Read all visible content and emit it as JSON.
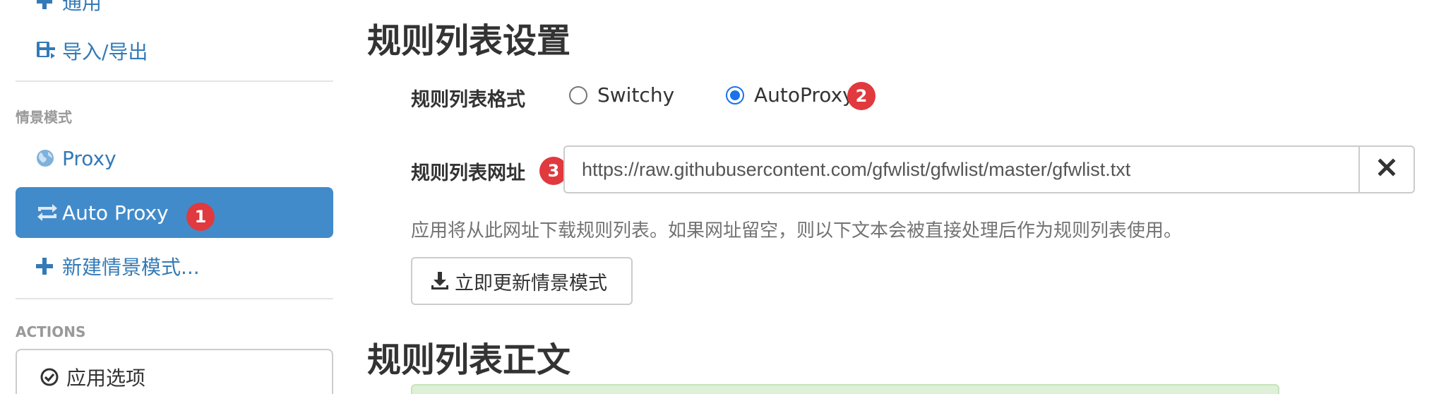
{
  "sidebar": {
    "cut_item_label": "通用",
    "import_export_label": "导入/导出",
    "profiles_section": "情景模式",
    "proxy_label": "Proxy",
    "auto_proxy_label": "Auto Proxy",
    "new_profile_label": "新建情景模式...",
    "actions_section": "ACTIONS",
    "apply_label": "应用选项",
    "badge_1": "1"
  },
  "main": {
    "rule_list_settings_title": "规则列表设置",
    "format_label": "规则列表格式",
    "format_options": [
      {
        "label": "Switchy",
        "checked": false
      },
      {
        "label": "AutoProxy",
        "checked": true
      }
    ],
    "badge_2": "2",
    "url_label": "规则列表网址",
    "badge_3": "3",
    "url_value": "https://raw.githubusercontent.com/gfwlist/gfwlist/master/gfwlist.txt",
    "help_text": "应用将从此网址下载规则列表。如果网址留空，则以下文本会被直接处理后作为规则列表使用。",
    "update_button_label": "立即更新情景模式",
    "rule_list_text_title": "规则列表正文"
  },
  "icons": {
    "import_export": "floppy-transfer-icon",
    "proxy": "globe-icon",
    "auto_proxy": "retweet-icon",
    "new_profile": "plus-icon",
    "apply": "check-circle-icon",
    "clear": "remove-icon",
    "update": "download-icon"
  },
  "colors": {
    "link": "#337ab7",
    "active_bg": "#428bca",
    "badge": "#e0393e",
    "radio_checked": "#1a73e8",
    "textarea_bg": "#dff0d8"
  }
}
